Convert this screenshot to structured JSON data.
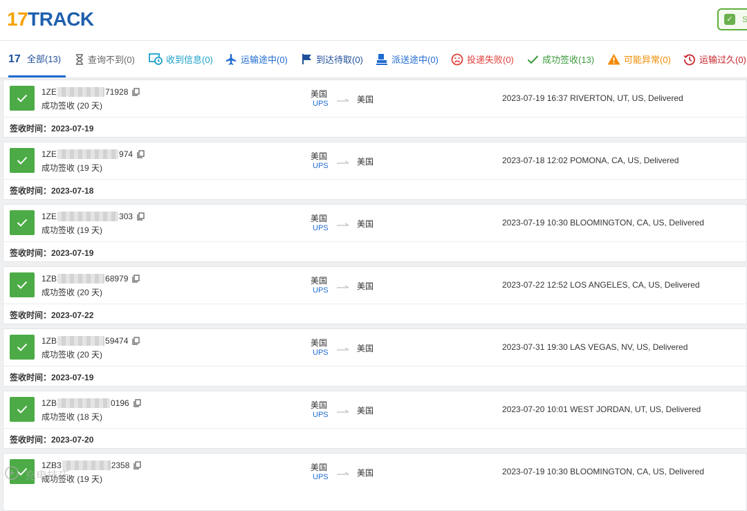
{
  "logo": {
    "num": "17",
    "word": "TRACK"
  },
  "header_button": {
    "label": "S"
  },
  "tabs": [
    {
      "id": "all",
      "label": "全部(13)",
      "icon": "17track-logo-icon",
      "color": "#1f4f99"
    },
    {
      "id": "notfound",
      "label": "查询不到(0)",
      "icon": "hourglass-icon",
      "color": "#666666"
    },
    {
      "id": "info",
      "label": "收到信息(0)",
      "icon": "info-received-icon",
      "color": "#1aa0c9"
    },
    {
      "id": "transit",
      "label": "运输途中(0)",
      "icon": "airplane-icon",
      "color": "#1f6bd1"
    },
    {
      "id": "pickup",
      "label": "到达待取(0)",
      "icon": "flag-icon",
      "color": "#1f4f99"
    },
    {
      "id": "delivering",
      "label": "派送途中(0)",
      "icon": "courier-icon",
      "color": "#1f6bd1"
    },
    {
      "id": "undelivered",
      "label": "投递失败(0)",
      "icon": "sad-face-icon",
      "color": "#e0413a"
    },
    {
      "id": "delivered",
      "label": "成功签收(13)",
      "icon": "check-icon",
      "color": "#3a9a3a"
    },
    {
      "id": "alert",
      "label": "可能异常(0)",
      "icon": "warning-icon",
      "color": "#f08a00"
    },
    {
      "id": "expired",
      "label": "运输过久(0)",
      "icon": "clock-history-icon",
      "color": "#c6252c"
    }
  ],
  "shipments": [
    {
      "num_start": "1ZE",
      "num_end": "71928",
      "status": "成功签收 (20 天)",
      "origin": "美国",
      "carrier": "UPS",
      "dest": "美国",
      "event": "2023-07-19 16:37  RIVERTON, UT, US, Delivered",
      "date_label": "签收时间：2023-07-19"
    },
    {
      "num_start": "1ZE",
      "num_end": "974",
      "status": "成功签收 (19 天)",
      "origin": "美国",
      "carrier": "UPS",
      "dest": "美国",
      "event": "2023-07-18 12:02  POMONA, CA, US, Delivered",
      "date_label": "签收时间：2023-07-18"
    },
    {
      "num_start": "1ZE",
      "num_end": "303",
      "status": "成功签收 (19 天)",
      "origin": "美国",
      "carrier": "UPS",
      "dest": "美国",
      "event": "2023-07-19 10:30  BLOOMINGTON, CA, US, Delivered",
      "date_label": "签收时间：2023-07-19"
    },
    {
      "num_start": "1ZB",
      "num_end": "68979",
      "status": "成功签收 (20 天)",
      "origin": "美国",
      "carrier": "UPS",
      "dest": "美国",
      "event": "2023-07-22 12:52  LOS ANGELES, CA, US, Delivered",
      "date_label": "签收时间：2023-07-22"
    },
    {
      "num_start": "1ZB",
      "num_end": "59474",
      "status": "成功签收 (20 天)",
      "origin": "美国",
      "carrier": "UPS",
      "dest": "美国",
      "event": "2023-07-31 19:30  LAS VEGAS, NV, US, Delivered",
      "date_label": "签收时间：2023-07-19"
    },
    {
      "num_start": "1ZB",
      "num_end": "0196",
      "status": "成功签收 (18 天)",
      "origin": "美国",
      "carrier": "UPS",
      "dest": "美国",
      "event": "2023-07-20 10:01  WEST JORDAN, UT, US, Delivered",
      "date_label": "签收时间：2023-07-20"
    },
    {
      "num_start": "1ZB3",
      "num_end": "2358",
      "status": "成功签收 (19 天)",
      "origin": "美国",
      "carrier": "UPS",
      "dest": "美国",
      "event": "2023-07-19 10:30  BLOOMINGTON, CA, US, Delivered",
      "date_label": ""
    }
  ],
  "watermark": "充电技巧"
}
